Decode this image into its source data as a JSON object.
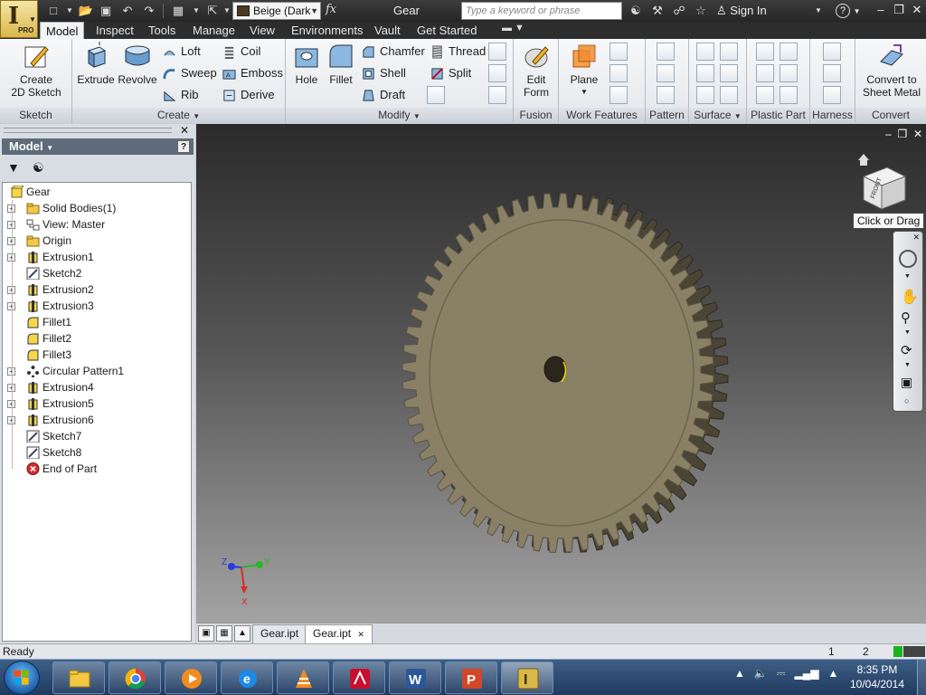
{
  "title_bar": {
    "material": "Beige (Dark",
    "fx_symbol": "fx",
    "document_title": "Gear",
    "search_placeholder": "Type a keyword or phrase",
    "sign_in": "Sign In",
    "help": "?"
  },
  "app_button": {
    "badge": "PRO"
  },
  "ribbon_tabs": [
    "Model",
    "Inspect",
    "Tools",
    "Manage",
    "View",
    "Environments",
    "Vault",
    "Get Started"
  ],
  "ribbon": {
    "sketch": {
      "title": "Sketch",
      "create_2d_sketch": "Create\n2D Sketch"
    },
    "create": {
      "title": "Create",
      "extrude": "Extrude",
      "revolve": "Revolve",
      "loft": "Loft",
      "sweep": "Sweep",
      "rib": "Rib",
      "coil": "Coil",
      "emboss": "Emboss",
      "derive": "Derive"
    },
    "modify": {
      "title": "Modify",
      "hole": "Hole",
      "fillet": "Fillet",
      "chamfer": "Chamfer",
      "shell": "Shell",
      "draft": "Draft",
      "thread": "Thread",
      "split": "Split"
    },
    "fusion": {
      "title": "Fusion",
      "edit_form": "Edit\nForm"
    },
    "work_features": {
      "title": "Work Features",
      "plane": "Plane"
    },
    "pattern": {
      "title": "Pattern"
    },
    "surface": {
      "title": "Surface"
    },
    "plastic_part": {
      "title": "Plastic Part"
    },
    "harness": {
      "title": "Harness"
    },
    "convert": {
      "title": "Convert",
      "convert_to_sheet_metal": "Convert to\nSheet Metal"
    }
  },
  "browser": {
    "title": "Model",
    "help": "?",
    "tree": [
      {
        "label": "Gear",
        "level": 0,
        "expander": false,
        "icon": "part-icon"
      },
      {
        "label": "Solid Bodies(1)",
        "level": 1,
        "expander": true,
        "icon": "folder-icon"
      },
      {
        "label": "View: Master",
        "level": 1,
        "expander": true,
        "icon": "view-icon"
      },
      {
        "label": "Origin",
        "level": 1,
        "expander": true,
        "icon": "folder-icon"
      },
      {
        "label": "Extrusion1",
        "level": 1,
        "expander": true,
        "icon": "extrusion-icon"
      },
      {
        "label": "Sketch2",
        "level": 1,
        "expander": false,
        "icon": "sketch-icon"
      },
      {
        "label": "Extrusion2",
        "level": 1,
        "expander": true,
        "icon": "extrusion-icon"
      },
      {
        "label": "Extrusion3",
        "level": 1,
        "expander": true,
        "icon": "extrusion-icon"
      },
      {
        "label": "Fillet1",
        "level": 1,
        "expander": false,
        "icon": "fillet-icon"
      },
      {
        "label": "Fillet2",
        "level": 1,
        "expander": false,
        "icon": "fillet-icon"
      },
      {
        "label": "Fillet3",
        "level": 1,
        "expander": false,
        "icon": "fillet-icon"
      },
      {
        "label": "Circular Pattern1",
        "level": 1,
        "expander": true,
        "icon": "circular-pattern-icon"
      },
      {
        "label": "Extrusion4",
        "level": 1,
        "expander": true,
        "icon": "extrusion-icon"
      },
      {
        "label": "Extrusion5",
        "level": 1,
        "expander": true,
        "icon": "extrusion-icon"
      },
      {
        "label": "Extrusion6",
        "level": 1,
        "expander": true,
        "icon": "extrusion-icon"
      },
      {
        "label": "Sketch7",
        "level": 1,
        "expander": false,
        "icon": "sketch-icon"
      },
      {
        "label": "Sketch8",
        "level": 1,
        "expander": false,
        "icon": "sketch-icon"
      },
      {
        "label": "End of Part",
        "level": 1,
        "expander": false,
        "icon": "end-of-part-icon"
      }
    ]
  },
  "viewport": {
    "viewcube_face": "FRONT",
    "viewcube_tooltip": "Click or Drag",
    "gear_color": "#8a8066",
    "gear_teeth": 60,
    "axes": {
      "x": "X",
      "y": "Y",
      "z": "Z"
    }
  },
  "doc_tabs": [
    {
      "label": "Gear.ipt",
      "active": false
    },
    {
      "label": "Gear.ipt",
      "active": true
    }
  ],
  "status_bar": {
    "text": "Ready",
    "count1": "1",
    "count2": "2"
  },
  "taskbar": {
    "apps": [
      "explorer",
      "chrome",
      "media-player",
      "internet-explorer",
      "vlc",
      "acrobat",
      "word",
      "powerpoint",
      "inventor"
    ],
    "time": "8:35 PM",
    "date": "10/04/2014"
  }
}
